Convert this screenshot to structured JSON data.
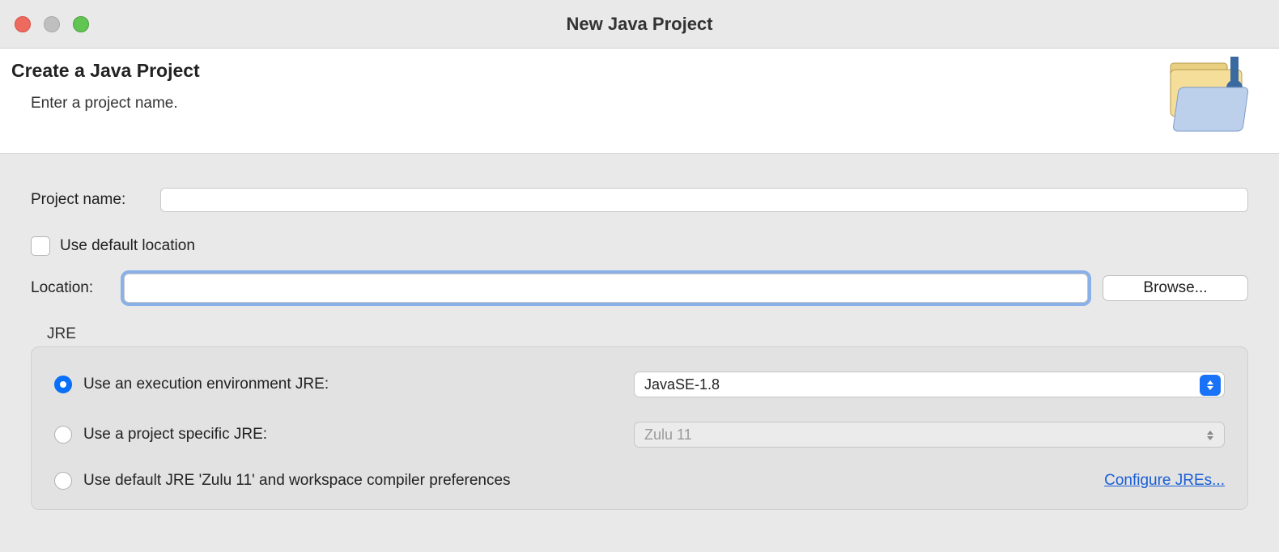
{
  "window": {
    "title": "New Java Project"
  },
  "header": {
    "title": "Create a Java Project",
    "subtitle": "Enter a project name."
  },
  "form": {
    "project_name_label": "Project name:",
    "project_name_value": "",
    "use_default_location_label": "Use default location",
    "use_default_location_checked": false,
    "location_label": "Location:",
    "location_value": "",
    "browse_label": "Browse..."
  },
  "jre": {
    "group_label": "JRE",
    "options": [
      {
        "label": "Use an execution environment JRE:",
        "selected": true
      },
      {
        "label": "Use a project specific JRE:",
        "selected": false
      },
      {
        "label": "Use default JRE 'Zulu 11' and workspace compiler preferences",
        "selected": false
      }
    ],
    "env_select_value": "JavaSE-1.8",
    "specific_select_value": "Zulu 11",
    "configure_link": "Configure JREs..."
  }
}
